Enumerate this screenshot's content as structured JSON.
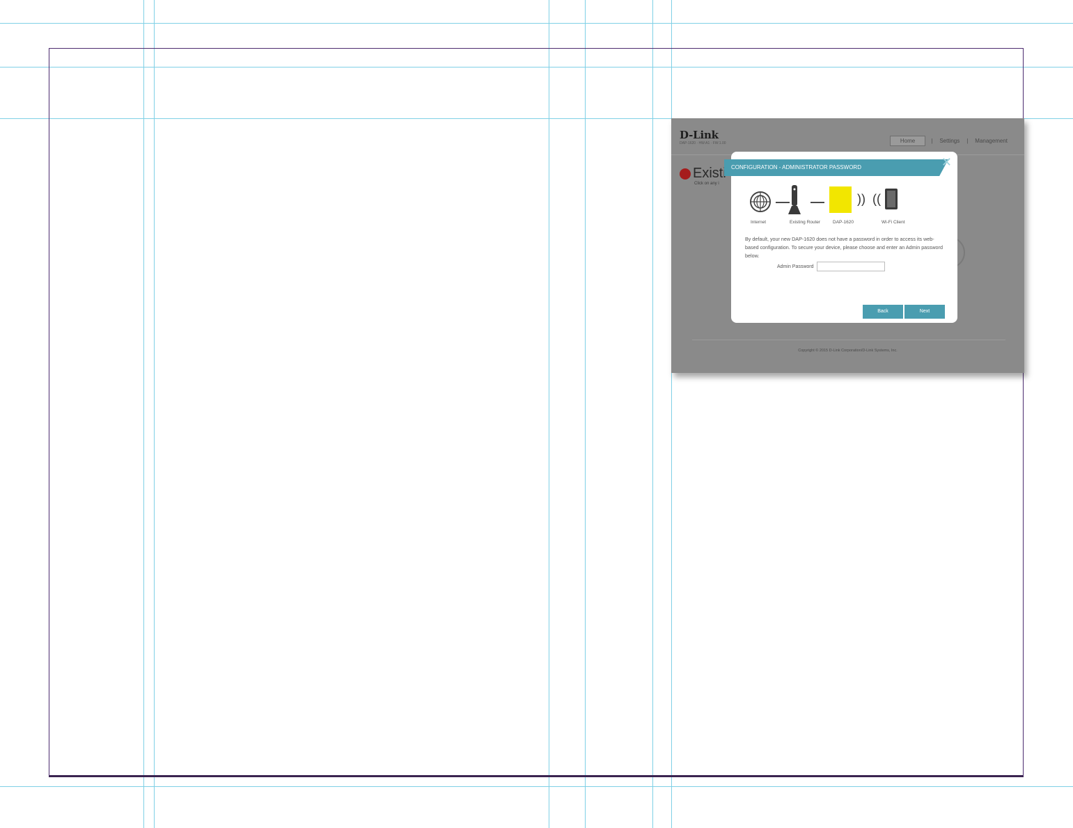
{
  "app": {
    "logo": "D-Link",
    "logo_sub": "DAP-1620 · HW:A1 · FW:1.00",
    "nav": [
      "Home",
      "Settings",
      "Management"
    ]
  },
  "page": {
    "heading": "Existi",
    "hint": "Click on any i"
  },
  "modal": {
    "title": "CONFIGURATION - ADMINISTRATOR PASSWORD",
    "close_icon": "close-icon",
    "diagram_labels": [
      "Internet",
      "Existing Router",
      "DAP-1620",
      "Wi-Fi Client"
    ],
    "body": "By default, your new DAP-1620 does not have a password in order to access its web-based configuration. To secure your device, please choose and enter an Admin password below.",
    "password_label": "Admin Password",
    "password_value": "",
    "buttons": {
      "back": "Back",
      "next": "Next"
    }
  },
  "footer": {
    "copyright": "Copyright © 2015 D-Link Corporation/D-Link Systems, Inc."
  },
  "colors": {
    "accent": "#4a9db0",
    "device": "#f2e600",
    "status_dot": "#a51c1c",
    "overlay": "#8a8a8a"
  }
}
